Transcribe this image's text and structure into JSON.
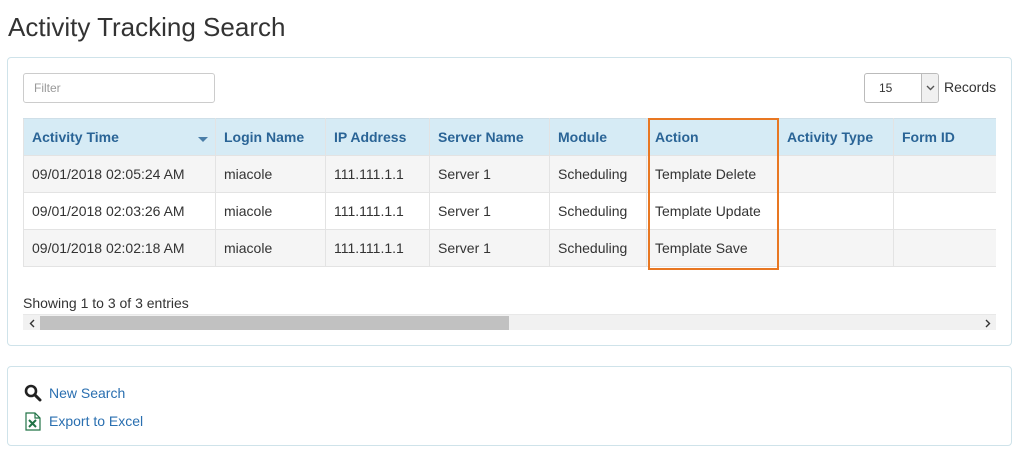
{
  "page": {
    "title": "Activity Tracking Search"
  },
  "filter": {
    "placeholder": "Filter",
    "value": ""
  },
  "records": {
    "selected": "15",
    "label": "Records"
  },
  "table": {
    "columns": [
      "Activity Time",
      "Login Name",
      "IP Address",
      "Server Name",
      "Module",
      "Action",
      "Activity Type",
      "Form ID"
    ],
    "sorted_column": "Activity Time",
    "highlighted_column": "Action",
    "rows": [
      [
        "09/01/2018 02:05:24 AM",
        "miacole",
        "111.111.1.1",
        "Server 1",
        "Scheduling",
        "Template Delete",
        "",
        ""
      ],
      [
        "09/01/2018 02:03:26 AM",
        "miacole",
        "111.111.1.1",
        "Server 1",
        "Scheduling",
        "Template Update",
        "",
        ""
      ],
      [
        "09/01/2018 02:02:18 AM",
        "miacole",
        "111.111.1.1",
        "Server 1",
        "Scheduling",
        "Template Save",
        "",
        ""
      ]
    ],
    "info": "Showing 1 to 3 of 3 entries"
  },
  "actions": {
    "new_search": {
      "label": "New Search",
      "icon": "search-icon"
    },
    "export_excel": {
      "label": "Export to Excel",
      "icon": "excel-icon"
    }
  },
  "colors": {
    "header_bg": "#d6ebf5",
    "header_text": "#2a6496",
    "highlight": "#e87722",
    "link": "#2a6fb0"
  }
}
